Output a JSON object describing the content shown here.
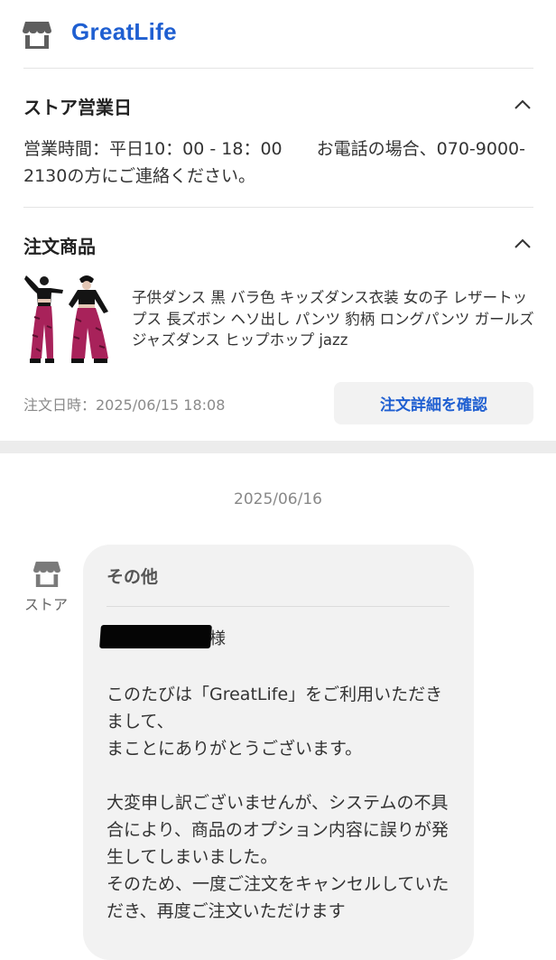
{
  "header": {
    "store_icon": "store-icon",
    "store_name": "GreatLife"
  },
  "store_hours": {
    "title": "ストア営業日",
    "toggle_icon": "chevron-up-icon",
    "text": "営業時間：平日10：00 - 18：00　　お電話の場合、070-9000-2130の方にご連絡ください。"
  },
  "order": {
    "title": "注文商品",
    "toggle_icon": "chevron-up-icon",
    "product_name": "子供ダンス 黒 バラ色 キッズダンス衣装 女の子 レザートップス 長ズボン ヘソ出し パンツ 豹柄 ロングパンツ ガールズ ジャズダンス ヒップホップ jazz",
    "order_date": "注文日時：2025/06/15 18:08",
    "detail_button": "注文詳細を確認"
  },
  "chat": {
    "date": "2025/06/16",
    "sender_icon": "store-icon",
    "sender_label": "ストア",
    "message": {
      "category": "その他",
      "name_suffix": "様",
      "greeting_1": "このたびは「GreatLife」をご利用いただきまして、",
      "greeting_2": "まことにありがとうございます。",
      "body_1": "大変申し訳ございませんが、システムの不具合により、商品のオプション内容に誤りが発生してしまいました。",
      "body_2": "そのため、一度ご注文をキャンセルしていただき、再度ご注文いただけます"
    }
  },
  "colors": {
    "accent": "#1f5fd1",
    "bubble": "#f2f2f2",
    "band": "#ececec"
  }
}
